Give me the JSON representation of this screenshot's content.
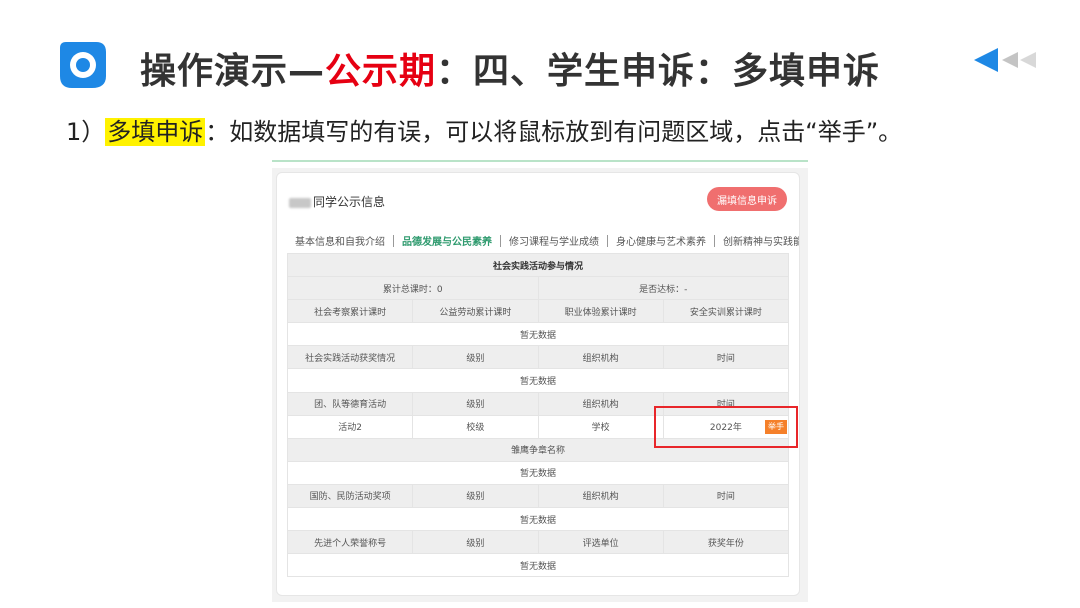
{
  "slide": {
    "title_prefix": "操作演示—",
    "title_highlight": "公示期",
    "title_suffix": "：四、学生申诉：多填申诉",
    "colors": {
      "highlight_red": "#e60012",
      "marker_yellow": "#fff200",
      "accent_blue": "#1e88e5"
    }
  },
  "instruction": {
    "prefix": "1）",
    "highlight": "多填申诉",
    "text": "：如数据填写的有误，可以将鼠标放到有问题区域，点击“举手”。"
  },
  "icons": [
    "app-logo-icon",
    "prev-arrow-icon"
  ],
  "screen": {
    "card_title": "同学公示信息",
    "appeal_button": "漏填信息申诉",
    "tabs": [
      "基本信息和自我介绍",
      "品德发展与公民素养",
      "修习课程与学业成绩",
      "身心健康与艺术素养",
      "创新精神与实践能力"
    ],
    "active_tab": "品德发展与公民素养",
    "raise_hand_label": "举手",
    "table": {
      "section_title": "社会实践活动参与情况",
      "total_hours": "累计总课时：0",
      "reached": "是否达标：-",
      "hours_headers": [
        "社会考察累计课时",
        "公益劳动累计课时",
        "职业体验累计课时",
        "安全实训累计课时"
      ],
      "no_data": "暂无数据",
      "award_headers": [
        "社会实践活动获奖情况",
        "级别",
        "组织机构",
        "时间"
      ],
      "activity_headers": [
        "团、队等德育活动",
        "级别",
        "组织机构",
        "时间"
      ],
      "activity_row": [
        "活动2",
        "校级",
        "学校",
        "2022年"
      ],
      "eagle_title": "雏鹰争章名称",
      "defense_headers": [
        "国防、民防活动奖项",
        "级别",
        "组织机构",
        "时间"
      ],
      "honor_headers": [
        "先进个人荣誉称号",
        "级别",
        "评选单位",
        "获奖年份"
      ]
    }
  }
}
